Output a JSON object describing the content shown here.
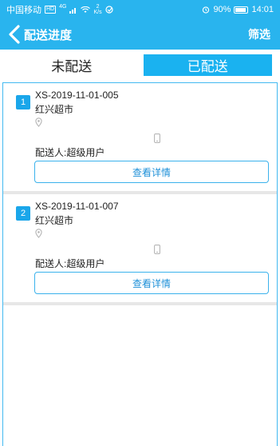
{
  "status_bar": {
    "carrier": "中国移动",
    "hd": "HD",
    "signal": "4G",
    "speed_value": "2",
    "speed_unit": "K/s",
    "battery": "90%",
    "time": "14:01"
  },
  "header": {
    "title": "配送进度",
    "filter_label": "筛选"
  },
  "tabs": [
    {
      "label": "未配送",
      "active": false
    },
    {
      "label": "已配送",
      "active": true
    }
  ],
  "orders": [
    {
      "index": "1",
      "order_no": "XS-2019-11-01-005",
      "store": "红兴超市",
      "driver": "配送人:超级用户",
      "detail_label": "查看详情"
    },
    {
      "index": "2",
      "order_no": "XS-2019-11-01-007",
      "store": "红兴超市",
      "driver": "配送人:超级用户",
      "detail_label": "查看详情"
    }
  ],
  "colors": {
    "accent": "#29b4ee",
    "tab_active": "#1ab2f0",
    "badge": "#1aa6ea",
    "button_text": "#1e90d8"
  }
}
